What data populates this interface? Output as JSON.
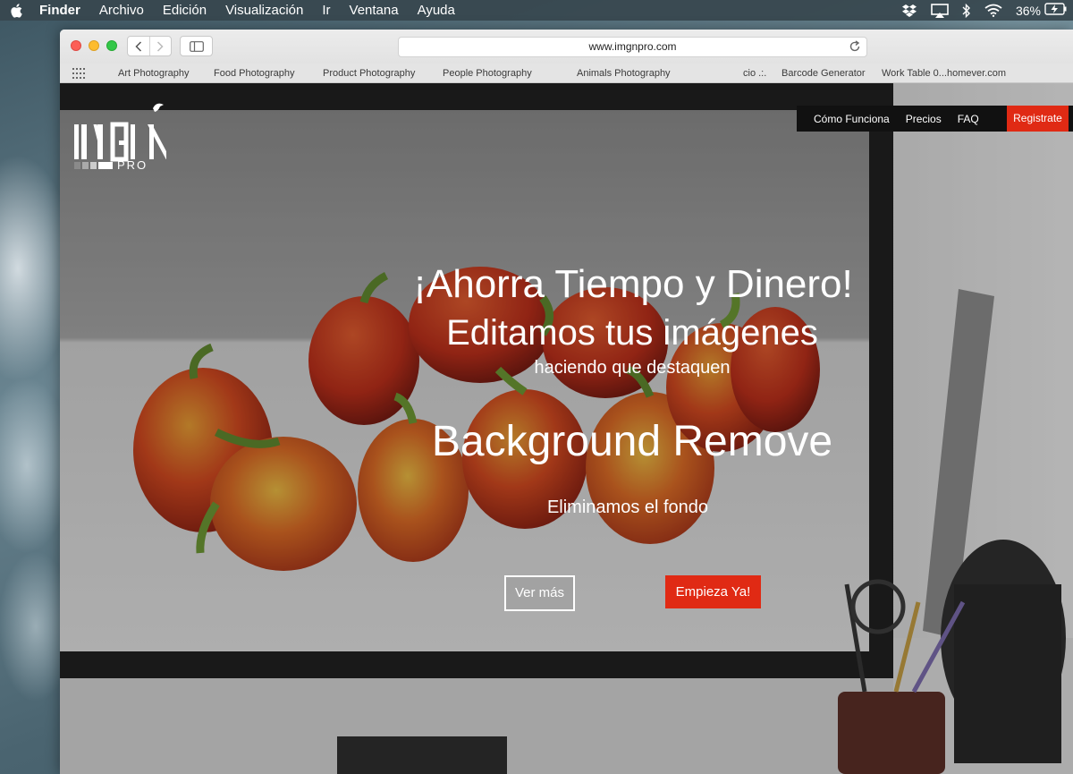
{
  "menubar": {
    "app_name": "Finder",
    "items": [
      "Archivo",
      "Edición",
      "Visualización",
      "Ir",
      "Ventana",
      "Ayuda"
    ],
    "battery": "36%",
    "tray_icons": [
      "dropbox-icon",
      "airplay-icon",
      "bluetooth-icon",
      "wifi-icon",
      "battery-charging-icon"
    ]
  },
  "browser": {
    "url": "www.imgnpro.com",
    "favorites": [
      "Art Photography",
      "Food Photography",
      "Product Photography",
      "People Photography",
      "Animals Photography",
      "cio .:.",
      "Barcode Generator",
      "Work Table 0...homever.com"
    ]
  },
  "site": {
    "logo_text": "IMGN",
    "logo_sub": "PRO",
    "nav": {
      "como_funciona": "Cómo Funciona",
      "precios": "Precios",
      "faq": "FAQ",
      "register": "Registrate"
    },
    "hero": {
      "headline": "¡Ahorra Tiempo y Dinero!",
      "subheadline": "Editamos tus imágenes",
      "tagline": "haciendo que destaquen",
      "service_title": "Background Remove",
      "service_sub": "Eliminamos el fondo",
      "btn_more": "Ver más",
      "btn_start": "Empieza Ya!"
    }
  },
  "colors": {
    "accent_red": "#e02a14",
    "nav_black": "#111111"
  }
}
